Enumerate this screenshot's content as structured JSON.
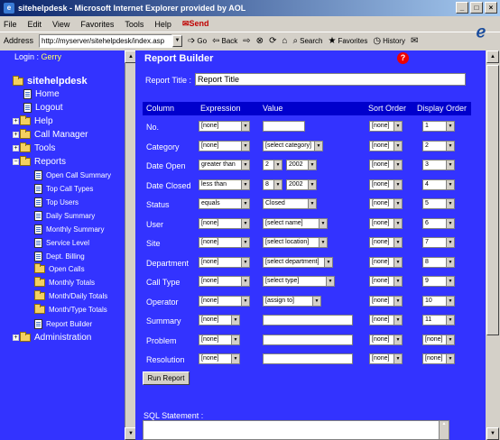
{
  "window": {
    "title": "sitehelpdesk - Microsoft Internet Explorer provided by AOL"
  },
  "menubar": {
    "items": [
      "File",
      "Edit",
      "View",
      "Favorites",
      "Tools",
      "Help"
    ],
    "send": "Send"
  },
  "toolbar": {
    "address_label": "Address",
    "address_value": "http://myserver/sitehelpdesk/index.asp",
    "go": "Go",
    "back": "Back",
    "search": "Search",
    "favorites": "Favorites",
    "history": "History"
  },
  "sidebar": {
    "login_label": "Login :",
    "login_user": "Gerry",
    "root": "sitehelpdesk",
    "items": [
      "Home",
      "Logout",
      "Help",
      "Call Manager",
      "Tools",
      "Reports",
      "Administration"
    ],
    "reports": [
      "Open Call Summary",
      "Top Call Types",
      "Top Users",
      "Daily Summary",
      "Monthly Summary",
      "Service Level",
      "Dept. Billing",
      "Open Calls",
      "Monthly Totals",
      "Month/Daily Totals",
      "Month/Type Totals",
      "Report Builder"
    ]
  },
  "main": {
    "title": "Report Builder",
    "report_title_label": "Report Title :",
    "report_title_value": "Report Title",
    "columns": [
      "Column",
      "Expression",
      "Value",
      "Sort Order",
      "Display Order"
    ],
    "rows": [
      {
        "label": "No.",
        "expr": "[none]",
        "value": "",
        "vtype": "text",
        "sort": "[none]",
        "disp": "1"
      },
      {
        "label": "Category",
        "expr": "[none]",
        "value": "[select category]",
        "vtype": "select",
        "sort": "[none]",
        "disp": "2"
      },
      {
        "label": "Date Open",
        "expr": "greater than",
        "value": "2",
        "value2": "2002",
        "vtype": "date",
        "sort": "[none]",
        "disp": "3"
      },
      {
        "label": "Date Closed",
        "expr": "less than",
        "value": "8",
        "value2": "2002",
        "vtype": "date",
        "sort": "[none]",
        "disp": "4"
      },
      {
        "label": "Status",
        "expr": "equals",
        "value": "Closed",
        "vtype": "select",
        "sort": "[none]",
        "disp": "5"
      },
      {
        "label": "User",
        "expr": "[none]",
        "value": "[select name]",
        "vtype": "select",
        "sort": "[none]",
        "disp": "6"
      },
      {
        "label": "Site",
        "expr": "[none]",
        "value": "[select location]",
        "vtype": "select",
        "sort": "[none]",
        "disp": "7"
      },
      {
        "label": "Department",
        "expr": "[none]",
        "value": "[select department]",
        "vtype": "select",
        "sort": "[none]",
        "disp": "8"
      },
      {
        "label": "Call Type",
        "expr": "[none]",
        "value": "[select type]",
        "vtype": "select",
        "sort": "[none]",
        "disp": "9"
      },
      {
        "label": "Operator",
        "expr": "[none]",
        "value": "[assign to]",
        "vtype": "select",
        "sort": "[none]",
        "disp": "10"
      },
      {
        "label": "Summary",
        "expr": "[none]",
        "value": "",
        "vtype": "text",
        "sort": "[none]",
        "disp": "11"
      },
      {
        "label": "Problem",
        "expr": "[none]",
        "value": "",
        "vtype": "text",
        "sort": "[none]",
        "disp": "[none]"
      },
      {
        "label": "Resolution",
        "expr": "[none]",
        "value": "",
        "vtype": "text",
        "sort": "[none]",
        "disp": "[none]"
      }
    ],
    "run_button": "Run Report",
    "sql_label": "SQL Statement :"
  }
}
